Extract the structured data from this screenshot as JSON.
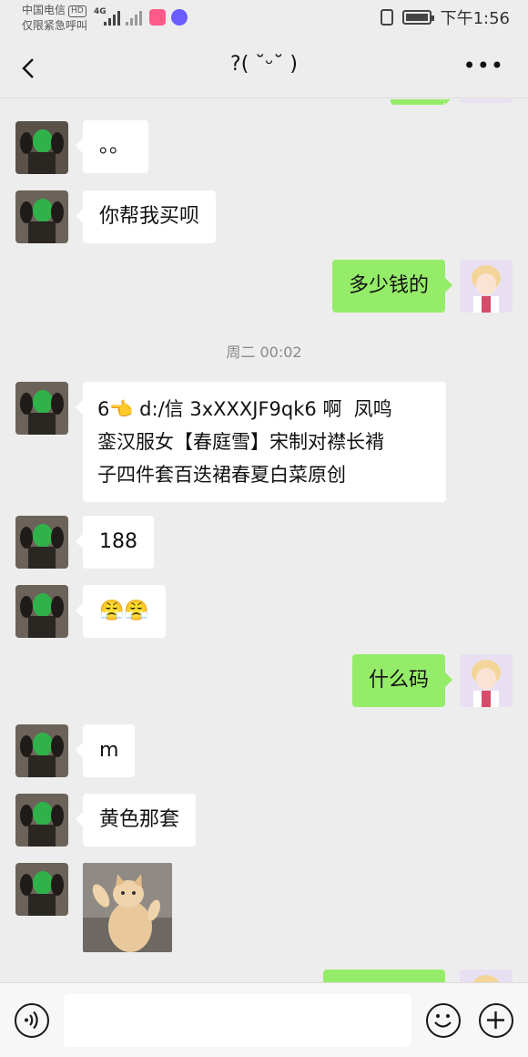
{
  "status_bar": {
    "carrier": "中国电信",
    "carrier_badge": "HD",
    "emergency_text": "仅限紧急呼叫",
    "network": "4G",
    "time": "下午1:56"
  },
  "header": {
    "title": "?( ˘ᵕ˘ )"
  },
  "messages": [
    {
      "sender": "other",
      "text": "。。"
    },
    {
      "sender": "other",
      "text": "你帮我买呗"
    },
    {
      "sender": "self",
      "text": "多少钱的"
    },
    {
      "timestamp": "周二 00:02"
    },
    {
      "sender": "other",
      "text": "6👈 d:/信 3xXXXJF9qk6 啊  凤鸣\n銮汉服女【春庭雪】宋制对襟长褙\n子四件套百迭裙春夏白菜原创"
    },
    {
      "sender": "other",
      "text": "188"
    },
    {
      "sender": "other",
      "text": "😤😤"
    },
    {
      "sender": "self",
      "text": "什么码"
    },
    {
      "sender": "other",
      "text": "m"
    },
    {
      "sender": "other",
      "text": "黄色那套"
    },
    {
      "sender": "other",
      "type": "sticker",
      "image": "cat-sticker"
    }
  ],
  "input_bar": {
    "voice_icon": "voice-icon",
    "emoji_icon": "emoji-icon",
    "plus_icon": "plus-icon"
  },
  "colors": {
    "background": "#ededed",
    "self_bubble": "#95ec69",
    "other_bubble": "#ffffff"
  }
}
